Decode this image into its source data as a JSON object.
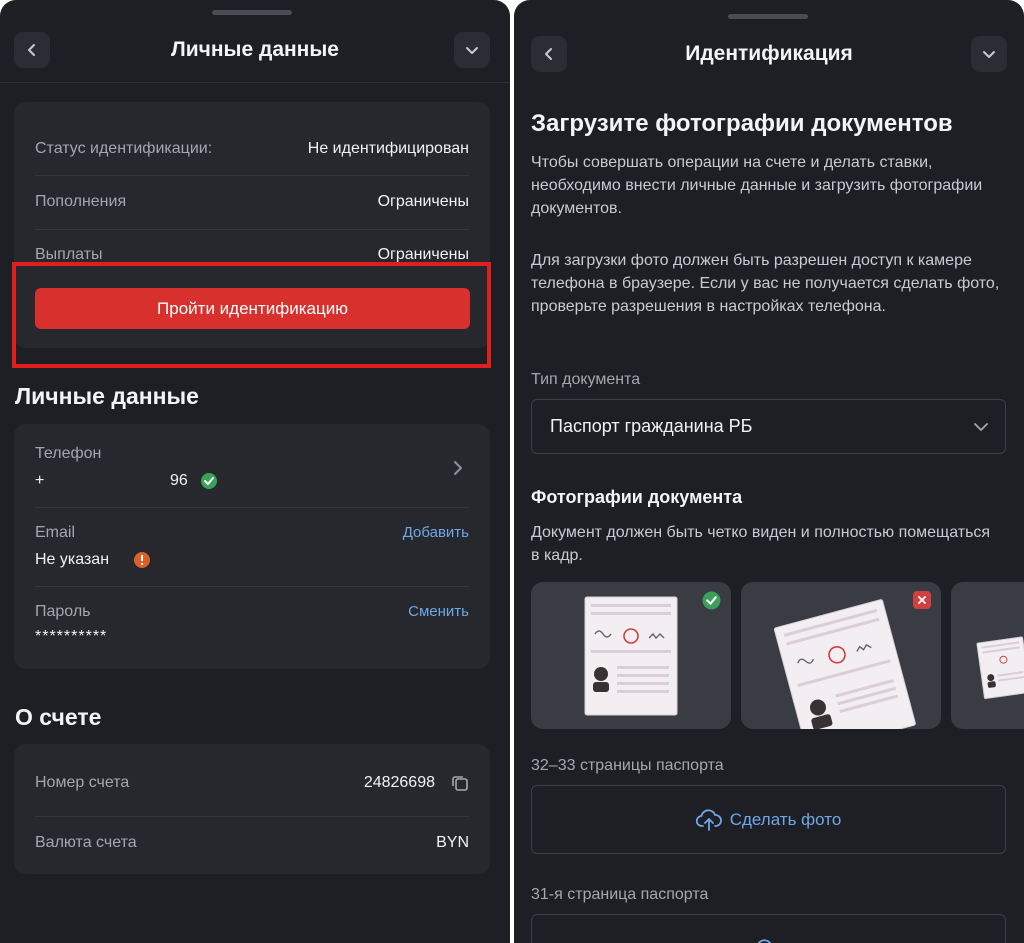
{
  "left": {
    "header": {
      "title": "Личные данные"
    },
    "status_card": {
      "rows": [
        {
          "label": "Статус идентификации:",
          "value": "Не идентифицирован"
        },
        {
          "label": "Пополнения",
          "value": "Ограничены"
        },
        {
          "label": "Выплаты",
          "value": "Ограничены"
        }
      ],
      "button_label": "Пройти идентификацию"
    },
    "personal": {
      "title": "Личные данные",
      "phone_label": "Телефон",
      "phone_prefix": "+",
      "phone_suffix": "96",
      "email_label": "Email",
      "email_value": "Не указан",
      "email_action": "Добавить",
      "password_label": "Пароль",
      "password_value": "**********",
      "password_action": "Сменить"
    },
    "account": {
      "title": "О счете",
      "number_label": "Номер счета",
      "number_value": "24826698",
      "currency_label": "Валюта счета",
      "currency_value": "BYN"
    }
  },
  "right": {
    "header": {
      "title": "Идентификация"
    },
    "heading": "Загрузите фотографии документов",
    "para1": "Чтобы совершать операции на счете и делать ставки, необходимо внести личные данные и загрузить фотографии документов.",
    "para2": "Для загрузки фото должен быть разрешен доступ к камере телефона в браузере. Если у вас не получается сделать фото, проверьте разрешения в настройках телефона.",
    "doc_type_label": "Тип документа",
    "doc_type_value": "Паспорт гражданина РБ",
    "photos_title": "Фотографии документа",
    "photos_desc": "Документ должен быть четко виден и полностью помещаться в кадр.",
    "section1_label": "32–33 страницы паспорта",
    "upload_label": "Сделать фото",
    "section2_label": "31-я страница паспорта"
  },
  "colors": {
    "accent_red": "#d8302d",
    "link_blue": "#6fa7e6",
    "ok_green": "#3aa05a",
    "warn_orange": "#d9622b",
    "bad_red": "#d04040"
  },
  "icons": [
    "back-chevron-icon",
    "collapse-chevron-icon",
    "check-circle-icon",
    "warning-circle-icon",
    "right-chevron-icon",
    "copy-icon",
    "upload-cloud-icon",
    "dropdown-chevron-icon"
  ]
}
